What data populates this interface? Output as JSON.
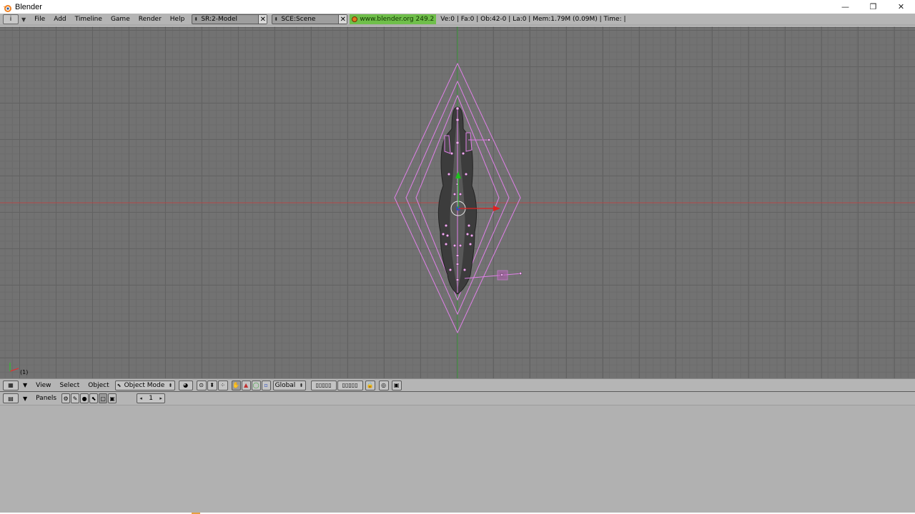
{
  "window": {
    "title": "Blender",
    "controls": {
      "minimize": "—",
      "restore": "❐",
      "close": "✕"
    }
  },
  "info_header": {
    "window_type_icon": "i",
    "menus": [
      "File",
      "Add",
      "Timeline",
      "Game",
      "Render",
      "Help"
    ],
    "screen_field": "SR:2-Model",
    "scene_field": "SCE:Scene",
    "url_badge": "www.blender.org 249.2",
    "stats": "Ve:0 | Fa:0 | Ob:42-0 | La:0  | Mem:1.79M (0.09M)  | Time: |"
  },
  "viewport": {
    "frame_label": "(1)",
    "background_color": "#727272",
    "grid_color": "#626262",
    "wire_color": "#e080e0",
    "x_axis_color": "#b04040",
    "y_axis_color": "#40a040"
  },
  "view3d_header": {
    "menus": [
      "View",
      "Select",
      "Object"
    ],
    "mode": "Object Mode",
    "orientation": "Global"
  },
  "buttons_header": {
    "label": "Panels",
    "frame_value": "1"
  }
}
